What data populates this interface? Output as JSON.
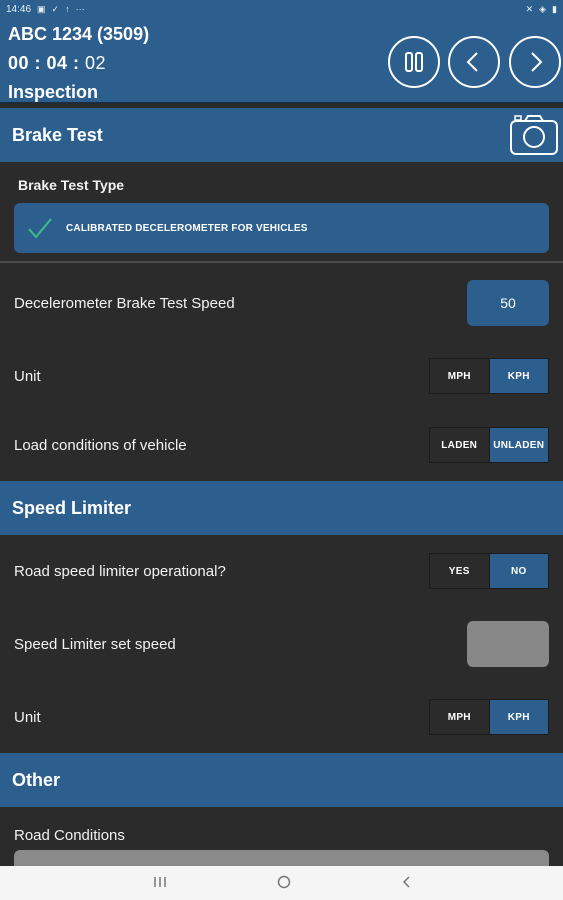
{
  "status_bar": {
    "time": "14:46",
    "icons_left": [
      "image-icon",
      "check-icon",
      "upload-icon",
      "more-icon"
    ],
    "icons_right": [
      "mute-icon",
      "wifi-icon",
      "battery-icon"
    ]
  },
  "header": {
    "vehicle": "ABC 1234 (3509)",
    "timer_hm": "00 : 04 :",
    "timer_s": " 02",
    "mode": "Inspection",
    "buttons": [
      "pause-button",
      "previous-button",
      "next-button"
    ]
  },
  "brake_test": {
    "title": "Brake Test",
    "type_label": "Brake Test Type",
    "type_value": "CALIBRATED DECELEROMETER FOR VEHICLES",
    "speed_label": "Decelerometer Brake Test Speed",
    "speed_value": "50",
    "unit_label": "Unit",
    "unit_options": [
      "MPH",
      "KPH"
    ],
    "unit_selected": "KPH",
    "load_label": "Load conditions of vehicle",
    "load_options": [
      "LADEN",
      "UNLADEN"
    ],
    "load_selected": "UNLADEN"
  },
  "speed_limiter": {
    "title": "Speed Limiter",
    "operational_label": "Road speed limiter operational?",
    "operational_options": [
      "YES",
      "NO"
    ],
    "operational_selected": "NO",
    "set_speed_label": "Speed Limiter set speed",
    "set_speed_value": "",
    "unit_label": "Unit",
    "unit_options": [
      "MPH",
      "KPH"
    ],
    "unit_selected": "KPH"
  },
  "other": {
    "title": "Other",
    "road_conditions_label": "Road Conditions"
  },
  "colors": {
    "primary": "#2d5f8e",
    "background": "#2b2b2b",
    "inactive": "#888888",
    "check": "#3bbf8a"
  }
}
